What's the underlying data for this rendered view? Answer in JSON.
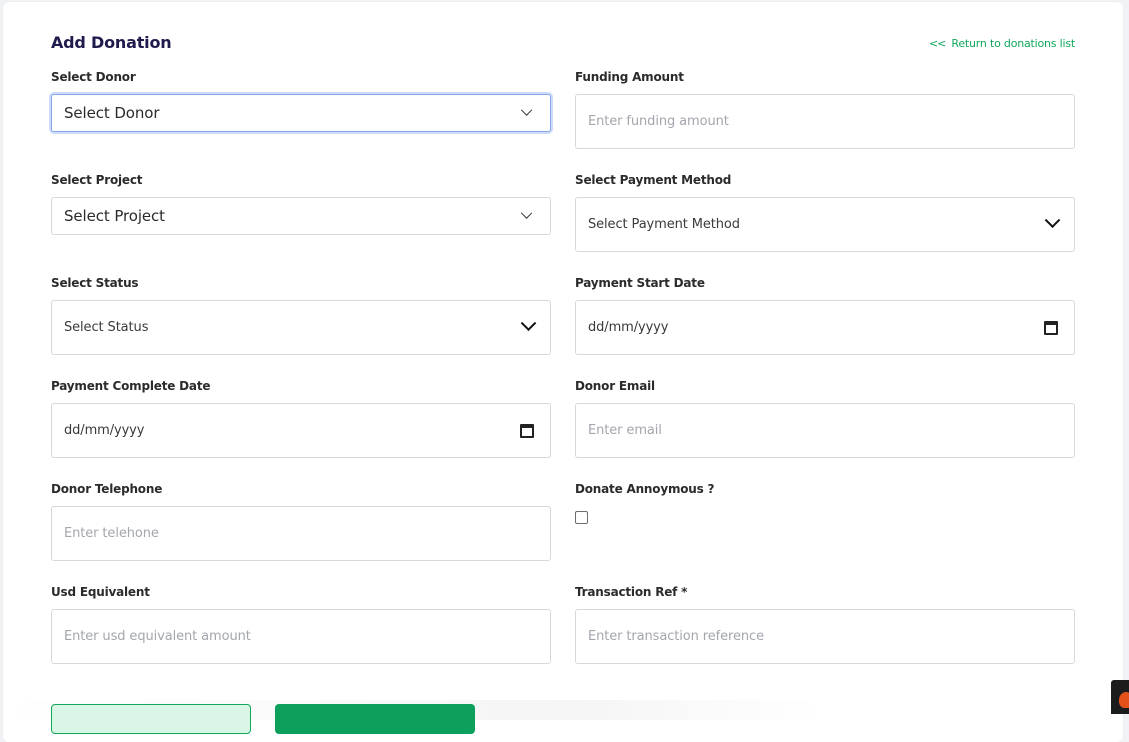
{
  "page": {
    "title": "Add Donation",
    "return_link": "Return to donations list",
    "return_chevron": "<<"
  },
  "fields": {
    "donor": {
      "label": "Select Donor",
      "value": "Select Donor"
    },
    "funding_amount": {
      "label": "Funding Amount",
      "placeholder": "Enter funding amount"
    },
    "project": {
      "label": "Select Project",
      "value": "Select Project"
    },
    "payment_method": {
      "label": "Select Payment Method",
      "value": "Select Payment Method"
    },
    "status": {
      "label": "Select Status",
      "value": "Select Status"
    },
    "payment_start_date": {
      "label": "Payment Start Date",
      "value": "dd/mm/yyyy"
    },
    "payment_complete_date": {
      "label": "Payment Complete Date",
      "value": "dd/mm/yyyy"
    },
    "donor_email": {
      "label": "Donor Email",
      "placeholder": "Enter email"
    },
    "donor_telephone": {
      "label": "Donor Telephone",
      "placeholder": "Enter telehone"
    },
    "donate_anonymous": {
      "label": "Donate Annoymous ?",
      "checked": false
    },
    "usd_equivalent": {
      "label": "Usd Equivalent",
      "placeholder": "Enter usd equivalent amount"
    },
    "transaction_ref": {
      "label": "Transaction Ref *",
      "placeholder": "Enter transaction reference"
    }
  },
  "icons": {
    "return": "double-chevron-left-icon",
    "select": "chevron-down-icon",
    "date": "calendar-icon"
  },
  "colors": {
    "accent": "#10a85b",
    "title": "#1f1b4d",
    "focus": "#86a8e8"
  }
}
